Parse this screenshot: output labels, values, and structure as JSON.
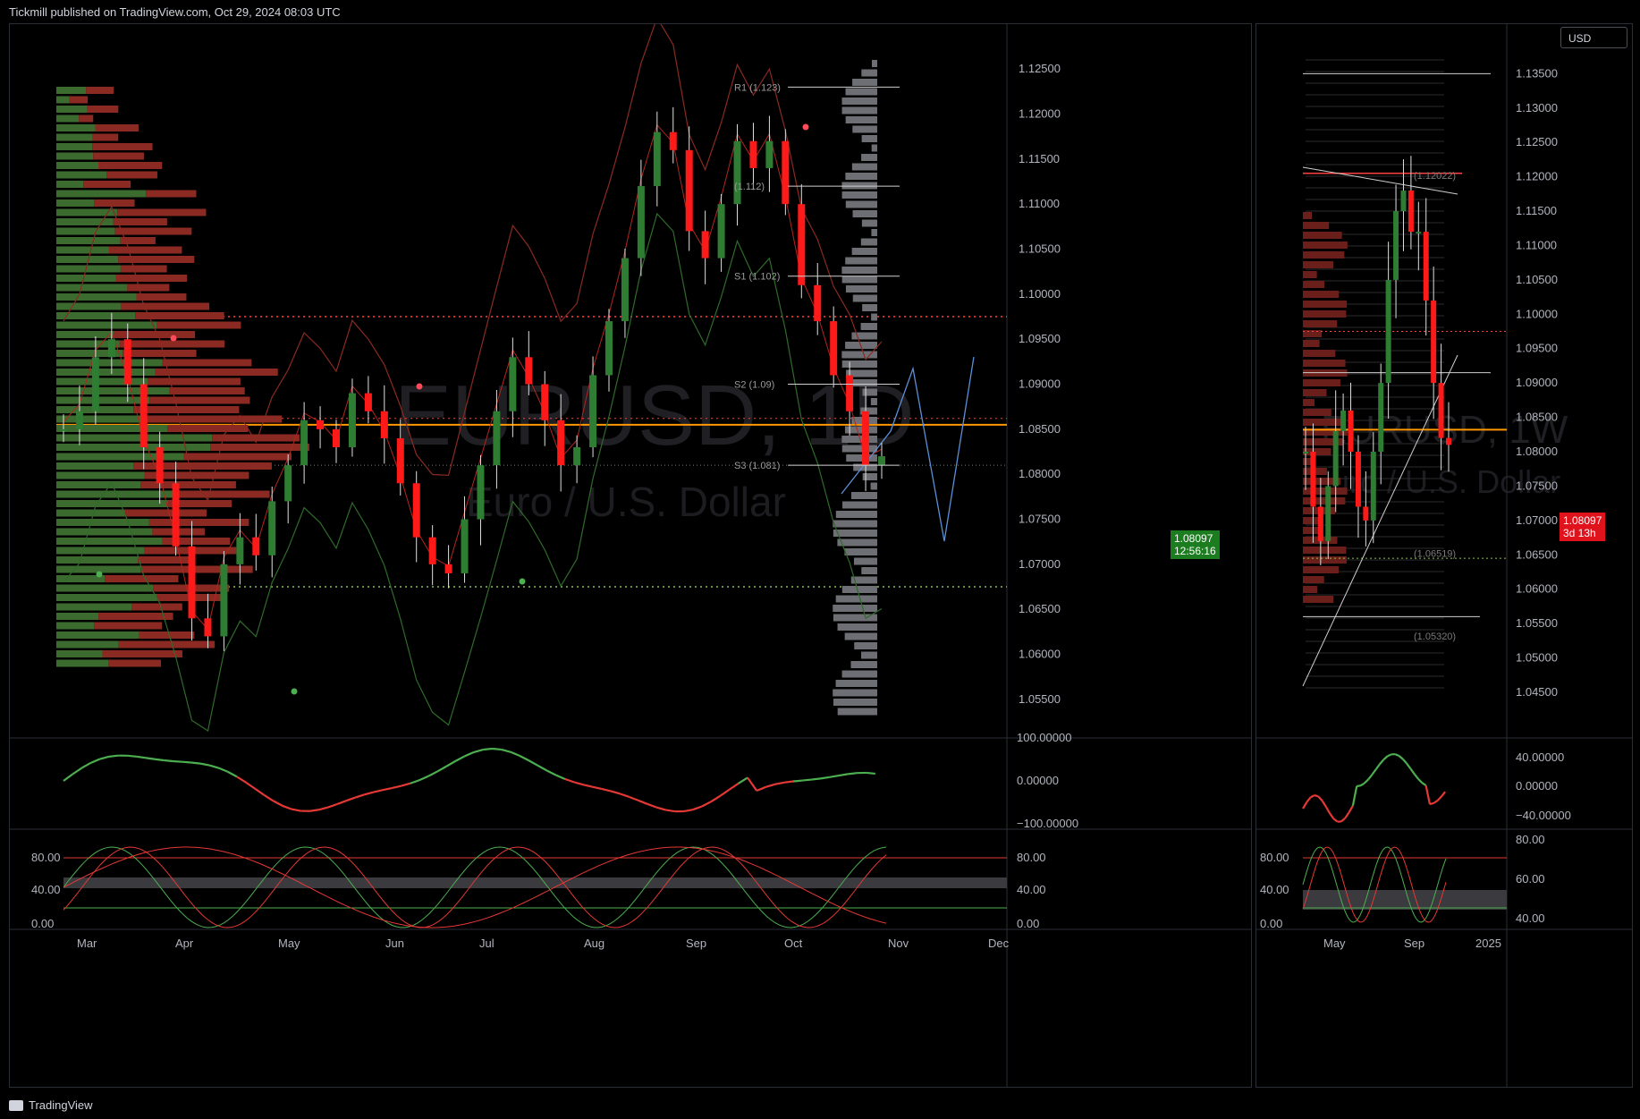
{
  "header": {
    "text": "Tickmill published on TradingView.com, Oct 29, 2024 08:03 UTC"
  },
  "footer": {
    "brand": "TradingView"
  },
  "colors": {
    "bull": "#2e7d32",
    "bear": "#ff1a1a",
    "poc": "#ff9800",
    "grid": "#2a2e39"
  },
  "usd_button": "USD",
  "left_chart": {
    "watermark_symbol": "EURUSD, 1D",
    "watermark_name": "Euro / U.S. Dollar",
    "current_price": "1.08097",
    "countdown": "12:56:16",
    "pivots": [
      {
        "label": "R1 (1.123)",
        "value": 1.123
      },
      {
        "label": "(1.112)",
        "value": 1.112
      },
      {
        "label": "S1 (1.102)",
        "value": 1.102
      },
      {
        "label": "S2 (1.09)",
        "value": 1.09
      },
      {
        "label": "S3 (1.081)",
        "value": 1.081
      }
    ],
    "y_ticks": [
      "1.12500",
      "1.12000",
      "1.11500",
      "1.11000",
      "1.10500",
      "1.10000",
      "1.09500",
      "1.09000",
      "1.08500",
      "1.08000",
      "1.07500",
      "1.07000",
      "1.06500",
      "1.06000",
      "1.05500"
    ],
    "x_ticks": [
      "Mar",
      "Apr",
      "May",
      "Jun",
      "Jul",
      "Aug",
      "Sep",
      "Oct",
      "Nov",
      "Dec"
    ],
    "osc1_ticks": [
      "100.00000",
      "0.00000",
      "−100.00000"
    ],
    "osc2_ticks": [
      "80.00",
      "40.00",
      "0.00"
    ]
  },
  "right_chart": {
    "watermark_symbol": "EURUSD, 1W",
    "watermark_name": "Euro / U.S. Dollar",
    "current_price": "1.08097",
    "countdown": "3d 13h",
    "annotations": [
      "(1.12022)",
      "(1.06519)",
      "(1.05320)"
    ],
    "y_ticks": [
      "1.13500",
      "1.13000",
      "1.12500",
      "1.12000",
      "1.11500",
      "1.11000",
      "1.10500",
      "1.10000",
      "1.09500",
      "1.09000",
      "1.08500",
      "1.08000",
      "1.07500",
      "1.07000",
      "1.06500",
      "1.06000",
      "1.05500",
      "1.05000",
      "1.04500"
    ],
    "x_ticks": [
      "May",
      "Sep",
      "2025"
    ],
    "osc1_ticks": [
      "40.00000",
      "0.00000",
      "−40.00000"
    ],
    "osc2_left_ticks": [
      "80.00",
      "40.00",
      "0.00"
    ],
    "osc2_right_ticks": [
      "80.00",
      "60.00",
      "40.00"
    ]
  },
  "chart_data": [
    {
      "type": "line",
      "title": "EURUSD, 1D",
      "ylim": [
        1.053,
        1.128
      ],
      "series": [
        {
          "values": [
            1.085,
            1.087,
            1.093,
            1.095,
            1.09,
            1.083,
            1.079,
            1.072,
            1.064,
            1.062,
            1.07,
            1.073,
            1.071,
            1.077,
            1.081,
            1.086,
            1.085,
            1.083,
            1.089,
            1.087,
            1.084,
            1.079,
            1.073,
            1.07,
            1.069,
            1.075,
            1.081,
            1.087,
            1.093,
            1.09,
            1.086,
            1.081,
            1.083,
            1.091,
            1.097,
            1.104,
            1.112,
            1.118,
            1.116,
            1.107,
            1.104,
            1.11,
            1.117,
            1.114,
            1.117,
            1.11,
            1.101,
            1.097,
            1.091,
            1.087,
            1.081,
            1.082
          ]
        }
      ]
    },
    {
      "type": "line",
      "title": "EURUSD, 1W",
      "ylim": [
        1.042,
        1.137
      ],
      "series": [
        {
          "values": [
            1.08,
            1.072,
            1.067,
            1.075,
            1.083,
            1.086,
            1.08,
            1.072,
            1.07,
            1.08,
            1.09,
            1.105,
            1.115,
            1.118,
            1.112,
            1.112,
            1.102,
            1.09,
            1.082,
            1.081
          ]
        }
      ]
    }
  ]
}
